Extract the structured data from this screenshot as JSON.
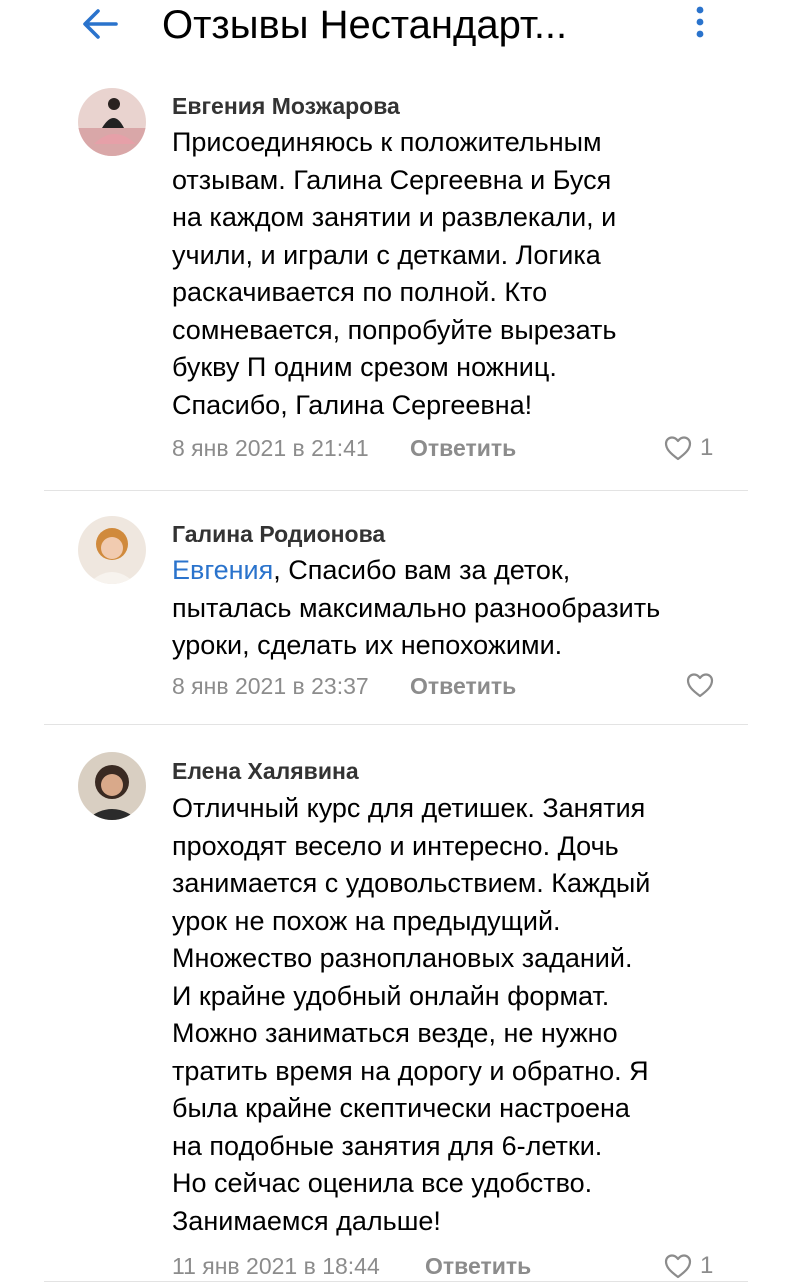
{
  "header": {
    "title": "Отзывы Нестандарт...",
    "back_icon": "arrow-left-icon",
    "menu_icon": "more-vertical-icon",
    "accent_color": "#2a73cc"
  },
  "comments": [
    {
      "author": "Евгения Мозжарова",
      "lines": [
        "Присоединяюсь к положительным",
        "отзывам. Галина Сергеевна и Буся",
        "на каждом занятии и развлекали, и",
        "учили, и играли с детками. Логика",
        "раскачивается по полной. Кто",
        "сомневается, попробуйте вырезать",
        "букву П одним срезом ножниц.",
        "Спасибо, Галина Сергеевна!"
      ],
      "date": "8 янв 2021 в 21:41",
      "reply_label": "Ответить",
      "likes": "1"
    },
    {
      "author": "Галина Родионова",
      "mention": "Евгения",
      "first_line_rest": ", Спасибо вам за деток,",
      "lines": [
        "пыталась максимально разнообразить",
        "уроки, сделать их непохожими."
      ],
      "date": "8 янв 2021 в 23:37",
      "reply_label": "Ответить"
    },
    {
      "author": "Елена Халявина",
      "lines": [
        "Отличный курс для детишек. Занятия",
        "проходят весело и интересно. Дочь",
        "занимается с удовольствием. Каждый",
        "урок не похож на предыдущий.",
        "Множество разноплановых заданий.",
        "И крайне удобный онлайн формат.",
        "Можно заниматься везде, не нужно",
        "тратить время на дорогу и обратно. Я",
        "была крайне скептически настроена",
        "на подобные занятия для 6-летки.",
        "Но сейчас оценила все удобство.",
        "Занимаемся дальше!"
      ],
      "date": "11 янв 2021 в 18:44",
      "reply_label": "Ответить",
      "likes": "1"
    }
  ]
}
